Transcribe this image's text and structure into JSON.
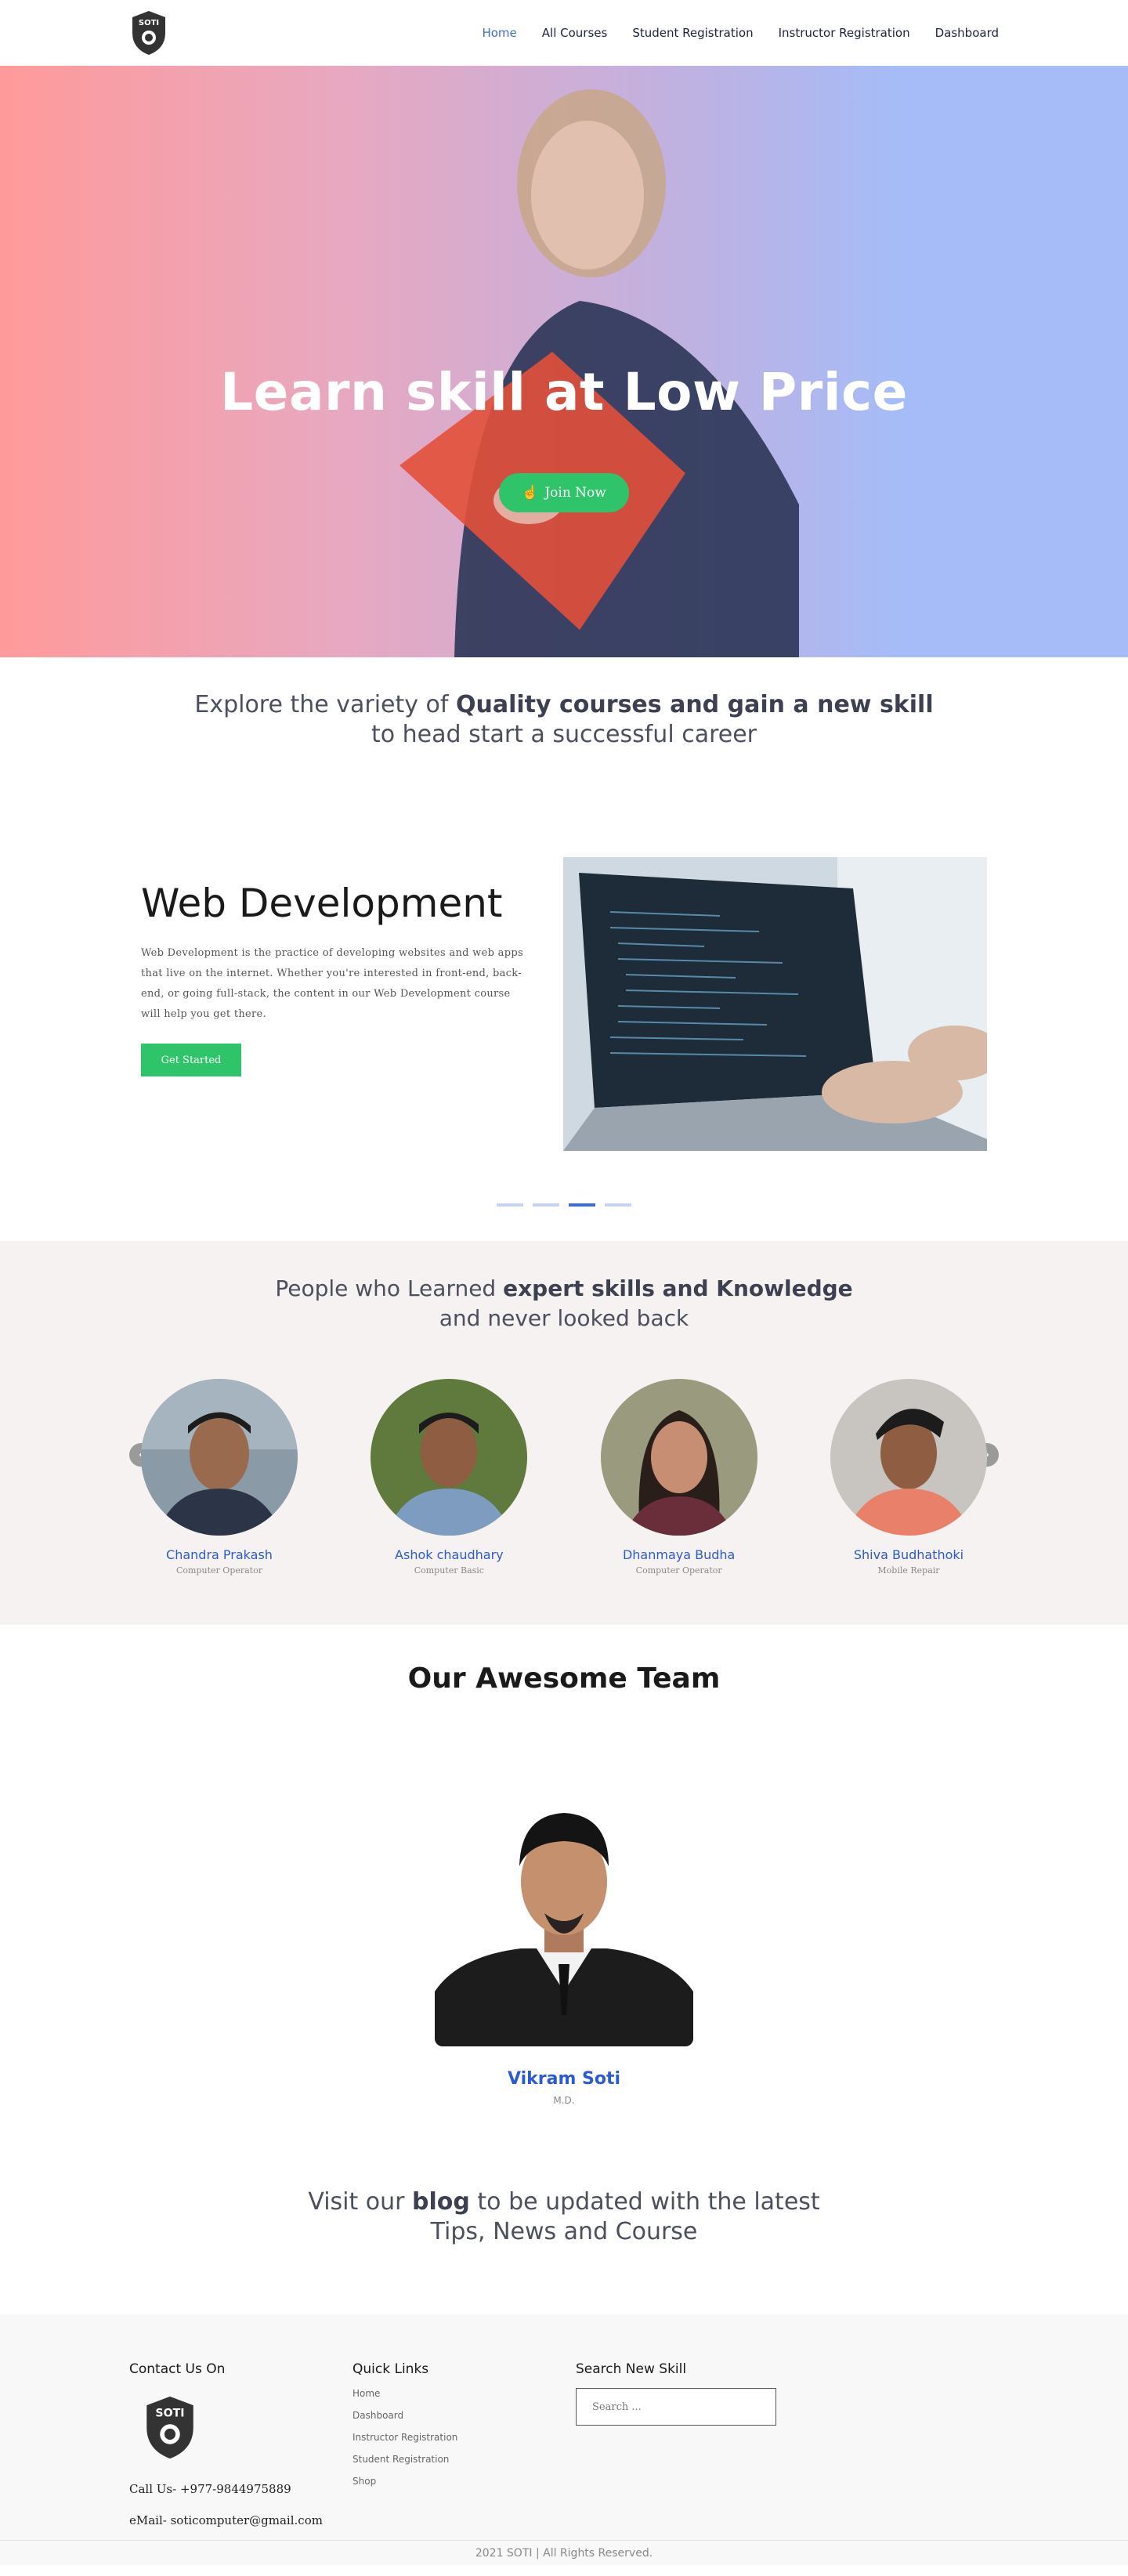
{
  "nav": {
    "items": [
      {
        "label": "Home",
        "active": true
      },
      {
        "label": "All Courses"
      },
      {
        "label": "Student Registration"
      },
      {
        "label": "Instructor Registration"
      },
      {
        "label": "Dashboard"
      }
    ]
  },
  "hero": {
    "title": "Learn skill at Low Price",
    "button": "Join Now"
  },
  "explore": {
    "prefix": "Explore the variety of ",
    "bold": "Quality courses and gain a new skill",
    "line2": "to head start a successful career"
  },
  "slider": {
    "title": "Web Development",
    "description": "Web Development is the practice of developing websites and web apps that live on the internet. Whether you're interested in front-end, back-end, or going full-stack, the content in our Web Development course will help you get there.",
    "button": "Get Started",
    "dots": 4,
    "active_dot": 3
  },
  "testimonials": {
    "prefix": "People who Learned ",
    "bold": "expert skills and Knowledge",
    "line2": "and never looked back",
    "people": [
      {
        "name": "Chandra Prakash",
        "role": "Computer Operator"
      },
      {
        "name": "Ashok chaudhary",
        "role": "Computer Basic"
      },
      {
        "name": "Dhanmaya Budha",
        "role": "Computer Operator"
      },
      {
        "name": "Shiva Budhathoki",
        "role": "Mobile Repair"
      }
    ]
  },
  "team": {
    "title": "Our Awesome Team",
    "member_name": "Vikram Soti",
    "member_role": "M.D."
  },
  "blog": {
    "prefix": "Visit our ",
    "bold": "blog",
    "suffix": " to be updated with the latest",
    "line2": "Tips, News and Course"
  },
  "footer": {
    "contact_title": "Contact Us On",
    "call": "Call Us- +977-9844975889",
    "email": "eMail- soticomputer@gmail.com",
    "links_title": "Quick Links",
    "links": [
      "Home",
      "Dashboard",
      "Instructor Registration",
      "Student Registration",
      "Shop"
    ],
    "search_title": "Search New Skill",
    "search_placeholder": "Search ...",
    "copyright": "2021 SOTI | All Rights Reserved."
  },
  "brand": {
    "logo_text": "SOTI",
    "accent": "#3b6fd8",
    "green": "#2fc36a"
  }
}
